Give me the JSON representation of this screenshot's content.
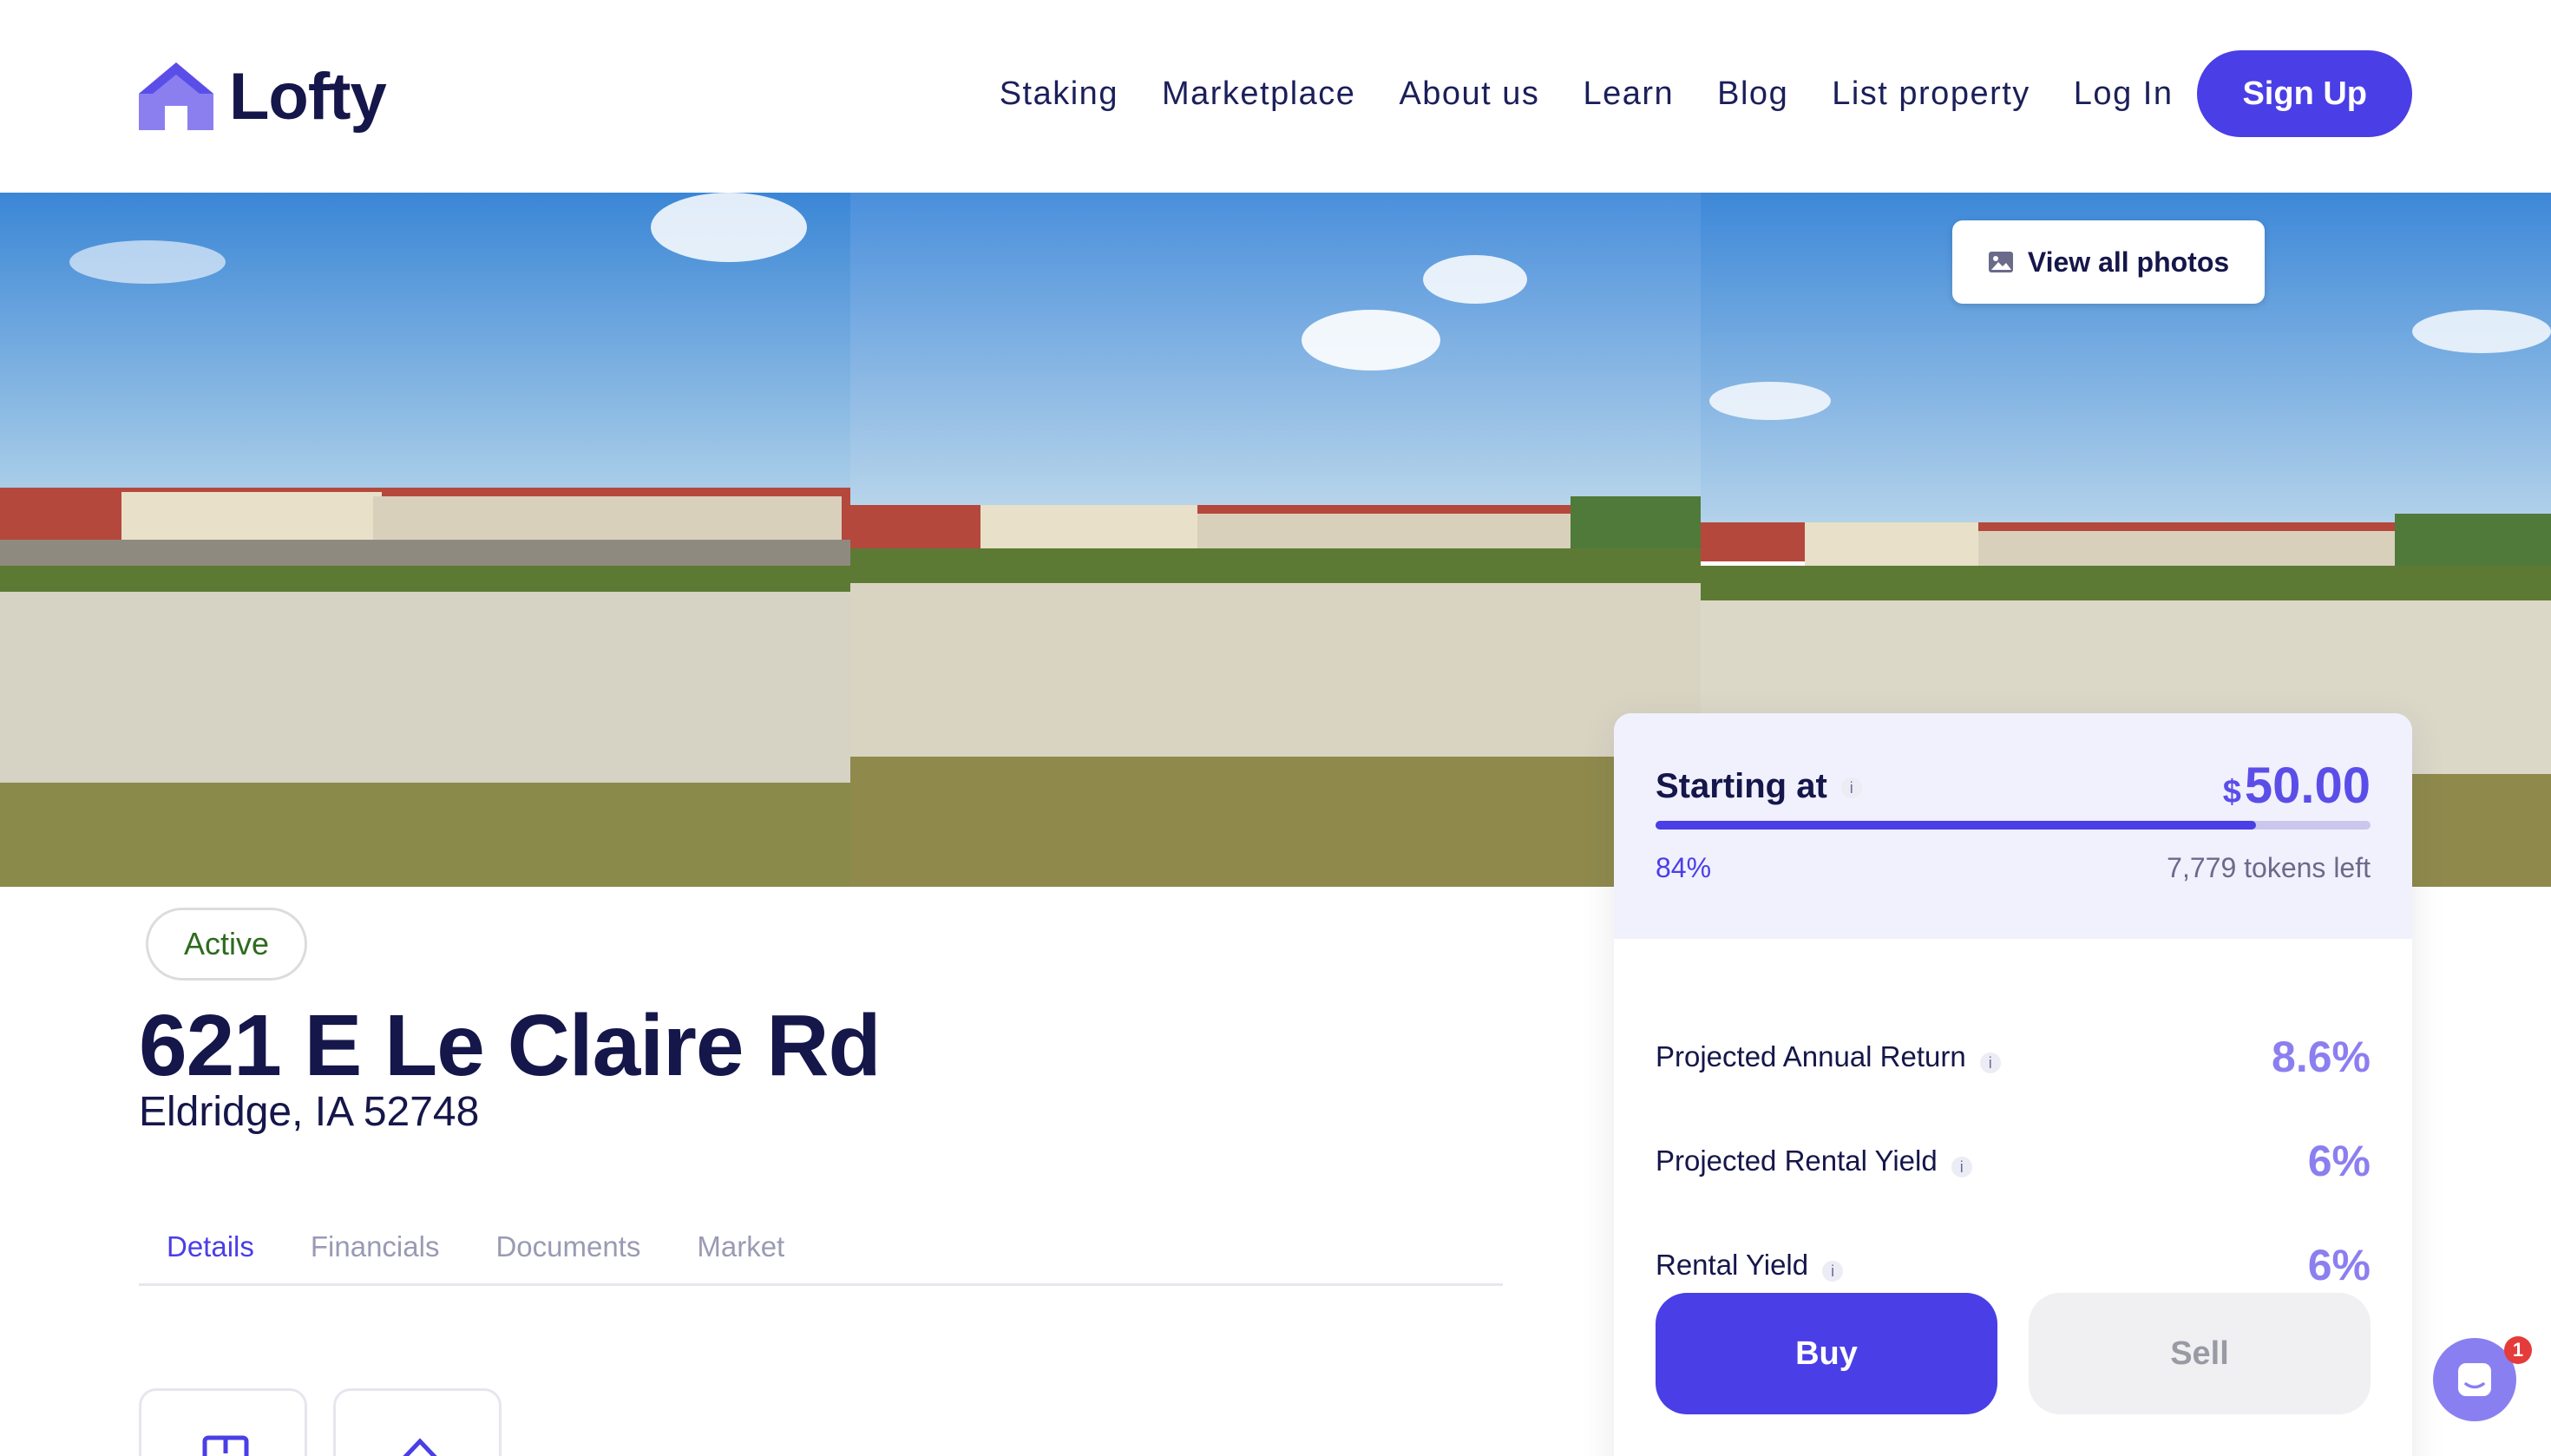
{
  "brand": {
    "name": "Lofty",
    "accent": "#4a3ee6"
  },
  "nav": {
    "items": [
      "Staking",
      "Marketplace",
      "About us",
      "Learn",
      "Blog",
      "List property"
    ],
    "login": "Log In",
    "signup": "Sign Up"
  },
  "gallery": {
    "view_all": "View all photos",
    "photo_count": 3
  },
  "property": {
    "status": "Active",
    "address": "621 E Le Claire Rd",
    "city": "Eldridge, IA 52748",
    "tabs": [
      "Details",
      "Financials",
      "Documents",
      "Market"
    ]
  },
  "invest": {
    "starting_label": "Starting at",
    "info_glyph": "i",
    "currency": "$",
    "price": "50.00",
    "progress_label": "84%",
    "progress_fraction": 0.84,
    "tokens_left": "7,779 tokens left",
    "metrics": [
      {
        "label": "Projected Annual Return",
        "value": "8.6%"
      },
      {
        "label": "Projected Rental Yield",
        "value": "6%"
      },
      {
        "label": "Rental Yield",
        "value": "6%"
      }
    ],
    "buy": "Buy",
    "sell": "Sell"
  },
  "chat": {
    "badge": "1"
  }
}
